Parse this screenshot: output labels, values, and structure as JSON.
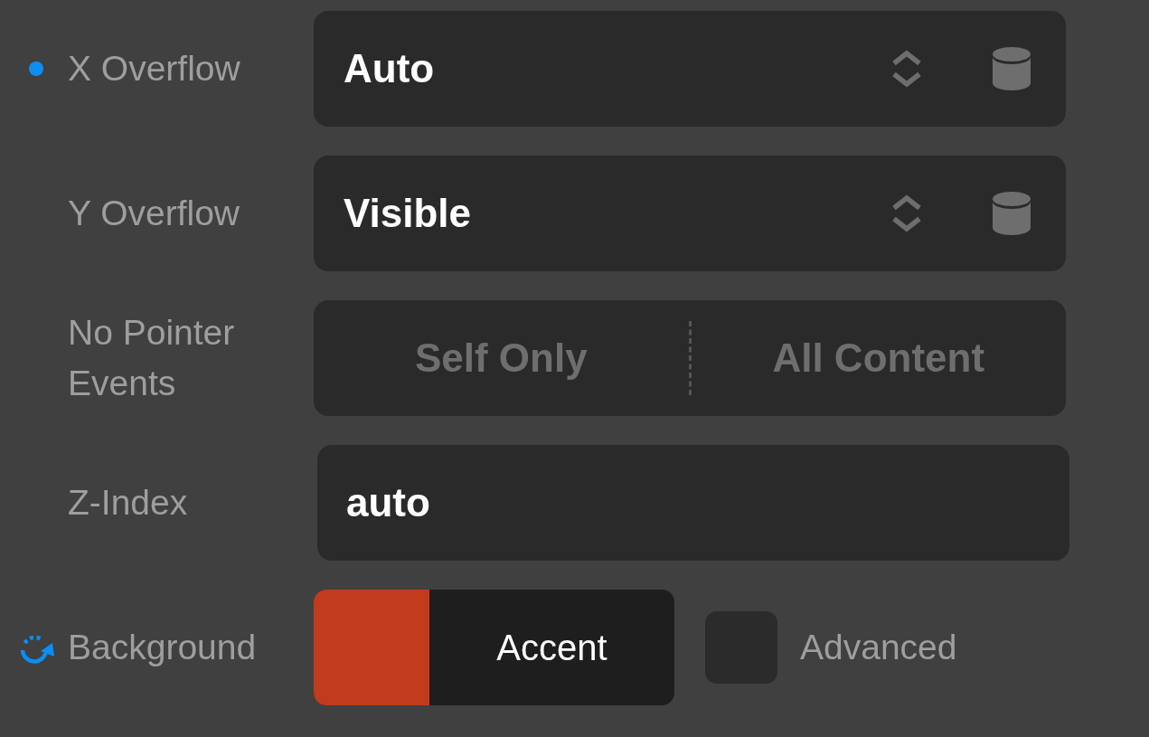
{
  "properties": [
    {
      "kind": "select",
      "modified": true,
      "label": "X Overflow",
      "value": "Auto"
    },
    {
      "kind": "select",
      "modified": false,
      "label": "Y Overflow",
      "value": "Visible"
    },
    {
      "kind": "segmented",
      "modified": false,
      "label": "No Pointer Events",
      "options": [
        {
          "label": "Self Only",
          "selected": false
        },
        {
          "label": "All Content",
          "selected": false
        }
      ]
    },
    {
      "kind": "input",
      "modified": false,
      "label": "Z-Index",
      "value": "auto"
    },
    {
      "kind": "color",
      "modified": true,
      "label": "Background",
      "color": "#c13b1c",
      "color_name": "Accent",
      "toggle": {
        "label": "Advanced",
        "checked": false
      }
    }
  ]
}
